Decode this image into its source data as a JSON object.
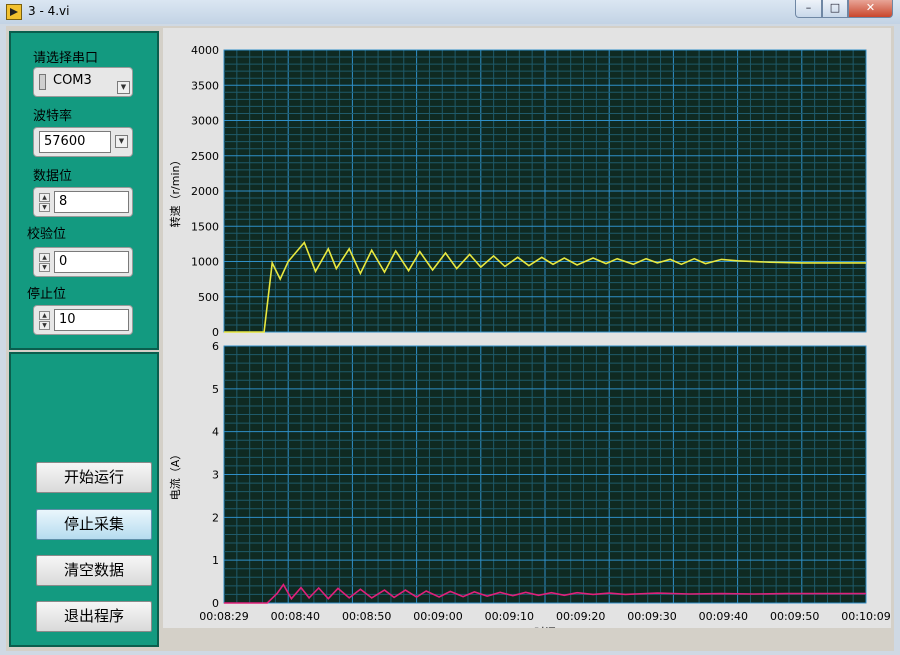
{
  "window": {
    "title": "3 - 4.vi",
    "min_glyph": "–",
    "max_glyph": "□",
    "close_glyph": "✕"
  },
  "config": {
    "port": {
      "label": "请选择串口",
      "value": "COM3"
    },
    "baud": {
      "label": "波特率",
      "value": "57600"
    },
    "databits": {
      "label": "数据位",
      "value": "8"
    },
    "parity": {
      "label": "校验位",
      "value": "0"
    },
    "stopbits": {
      "label": "停止位",
      "value": "10"
    }
  },
  "actions": {
    "start": "开始运行",
    "stop": "停止采集",
    "clear": "清空数据",
    "exit": "退出程序"
  },
  "colors": {
    "plot_bg": "#0f2a22",
    "grid_major": "#2f8fc8",
    "grid_minor": "#1f5a6a",
    "speed": "#e8e840",
    "current": "#e0207a",
    "panel": "#139a80"
  },
  "chart_data": [
    {
      "type": "line",
      "ylabel": "转速（r/min）",
      "ylim": [
        0,
        4000
      ],
      "yticks": [
        0,
        500,
        1000,
        1500,
        2000,
        2500,
        3000,
        3500,
        4000
      ],
      "xlim": [
        0,
        40
      ],
      "series": [
        {
          "x": [
            0,
            2.5,
            3,
            3.5,
            4,
            5,
            5.7,
            6.5,
            7,
            7.8,
            8.5,
            9.2,
            10,
            10.7,
            11.5,
            12.2,
            13,
            13.8,
            14.5,
            15.3,
            16,
            16.8,
            17.5,
            18.3,
            19,
            19.8,
            20.5,
            21.2,
            22,
            23,
            23.8,
            24.5,
            25.5,
            26.3,
            27,
            27.8,
            28.5,
            29.3,
            30,
            31,
            32,
            34,
            36,
            38,
            40
          ],
          "y": [
            0,
            0,
            980,
            750,
            1000,
            1270,
            860,
            1180,
            900,
            1180,
            830,
            1160,
            850,
            1150,
            870,
            1140,
            880,
            1120,
            900,
            1100,
            920,
            1080,
            930,
            1060,
            940,
            1060,
            960,
            1050,
            950,
            1050,
            970,
            1040,
            960,
            1040,
            980,
            1030,
            960,
            1040,
            970,
            1030,
            1010,
            990,
            980,
            980,
            980
          ]
        }
      ]
    },
    {
      "type": "line",
      "ylabel": "电流（A）",
      "xlabel": "时间",
      "ylim": [
        0,
        6
      ],
      "yticks": [
        0,
        1,
        2,
        3,
        4,
        5,
        6
      ],
      "xlim": [
        0,
        40
      ],
      "xticks": [
        "00:08:29",
        "00:08:40",
        "00:08:50",
        "00:09:00",
        "00:09:10",
        "00:09:20",
        "00:09:30",
        "00:09:40",
        "00:09:50",
        "00:10:09"
      ],
      "series": [
        {
          "x": [
            0,
            2.7,
            3.3,
            3.7,
            4.2,
            4.8,
            5.3,
            5.9,
            6.5,
            7.1,
            7.8,
            8.5,
            9.2,
            10,
            10.6,
            11.3,
            12,
            12.6,
            13.4,
            14.1,
            14.9,
            15.6,
            16.4,
            17.2,
            18,
            18.8,
            19.6,
            20.4,
            21.2,
            22,
            23,
            24,
            25,
            27,
            29,
            31,
            33,
            35,
            37,
            40
          ],
          "y": [
            0,
            0,
            0.22,
            0.43,
            0.1,
            0.36,
            0.12,
            0.35,
            0.1,
            0.34,
            0.12,
            0.32,
            0.12,
            0.3,
            0.13,
            0.3,
            0.14,
            0.28,
            0.14,
            0.27,
            0.15,
            0.26,
            0.16,
            0.25,
            0.17,
            0.25,
            0.18,
            0.24,
            0.18,
            0.24,
            0.2,
            0.23,
            0.2,
            0.23,
            0.21,
            0.22,
            0.21,
            0.22,
            0.22,
            0.22
          ]
        }
      ]
    }
  ]
}
